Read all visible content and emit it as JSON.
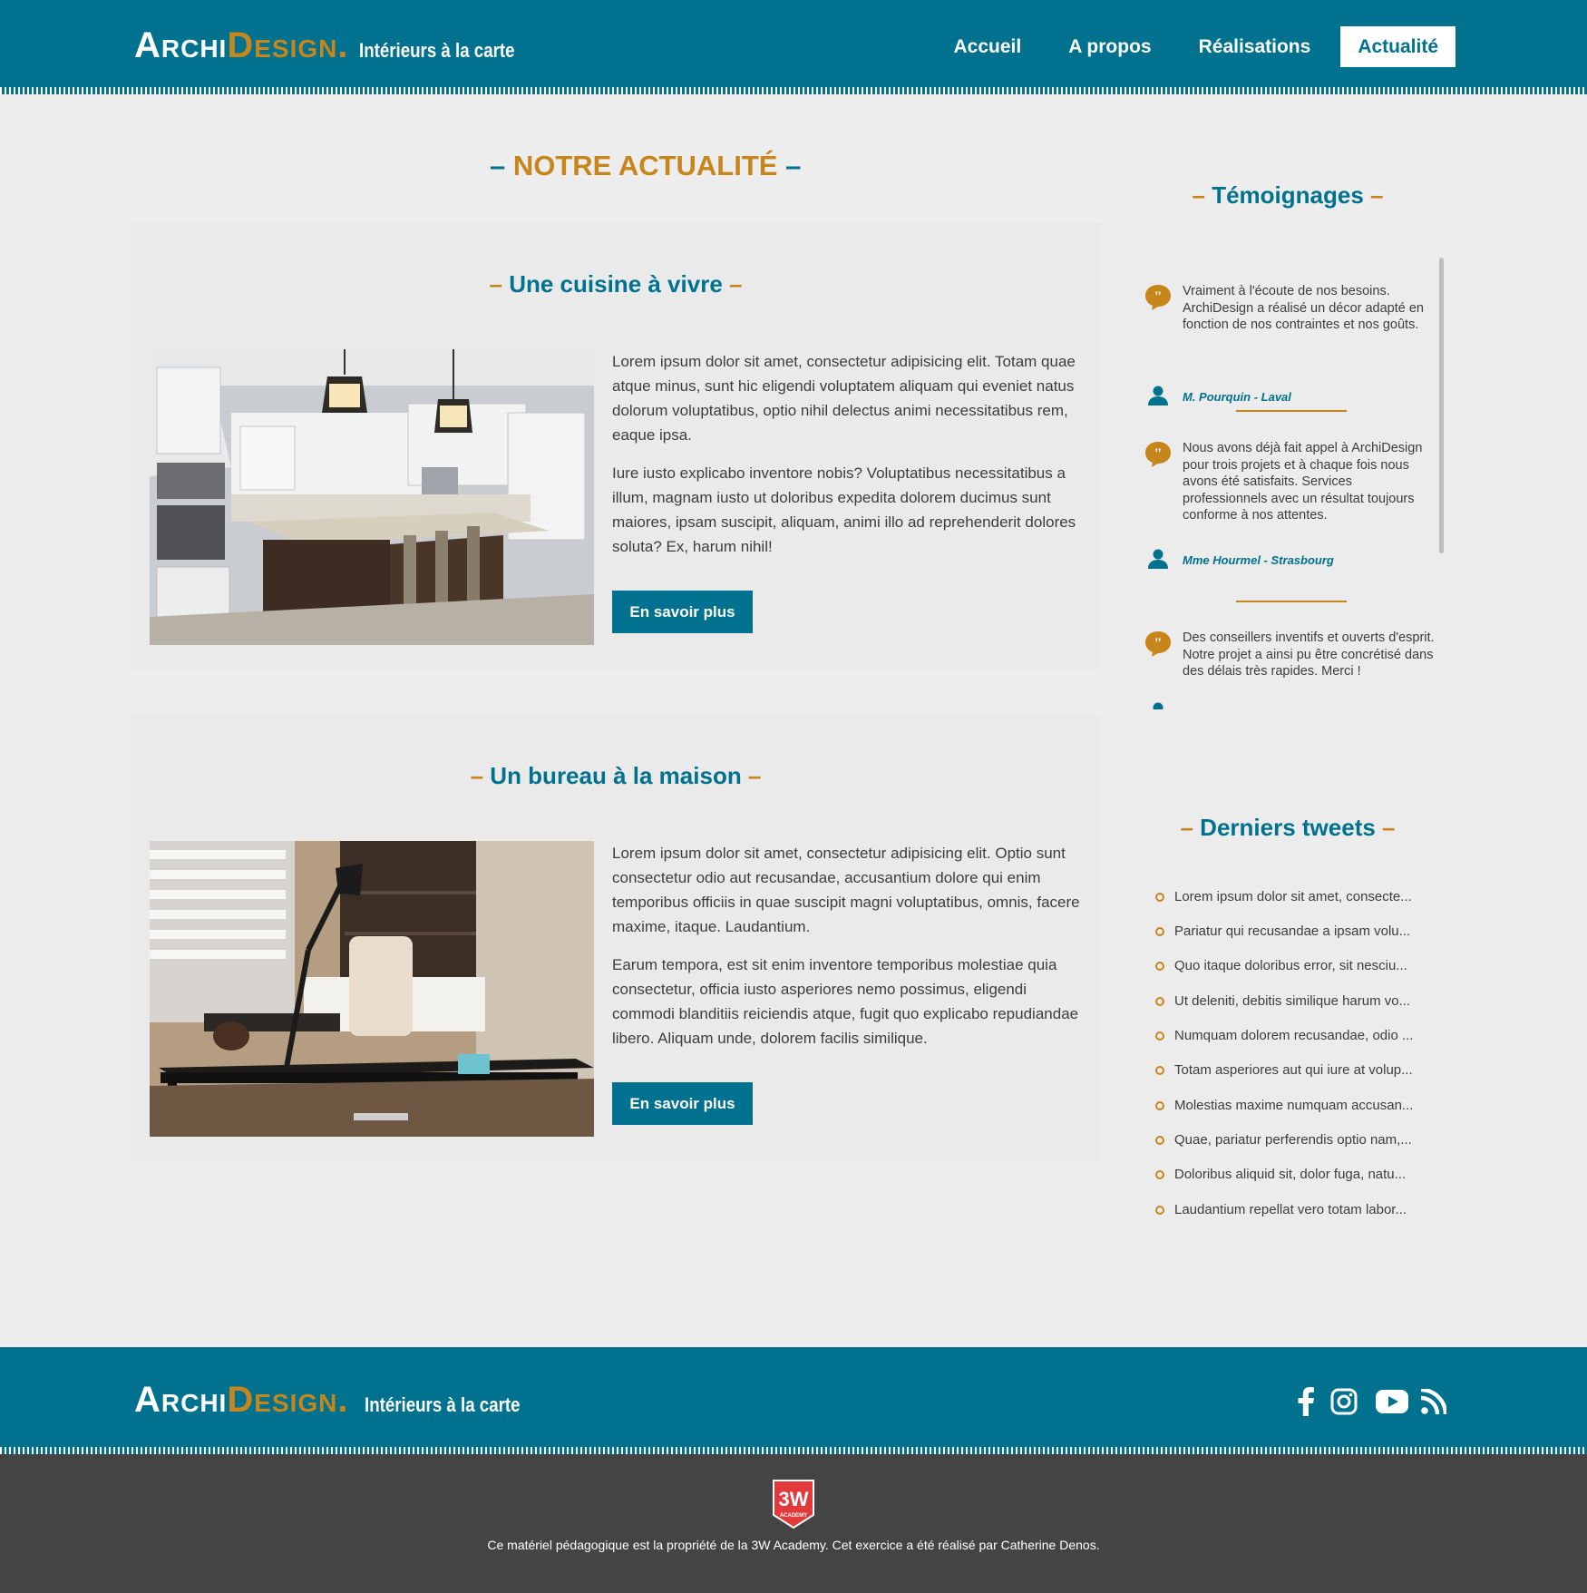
{
  "brand": {
    "archi": "Archi",
    "design": "Design",
    "dot": ".",
    "tagline": "Intérieurs à la carte"
  },
  "nav": [
    {
      "label": "Accueil"
    },
    {
      "label": "A propos"
    },
    {
      "label": "Réalisations"
    },
    {
      "label": "Actualité"
    }
  ],
  "page_title": "NOTRE ACTUALITÉ",
  "articles": [
    {
      "title": "Une cuisine à vivre",
      "p1": "Lorem ipsum dolor sit amet, consectetur adipisicing elit. Totam quae atque minus, sunt hic eligendi voluptatem aliquam qui eveniet natus dolorum voluptatibus, optio nihil delectus animi necessitatibus rem, eaque ipsa.",
      "p2": "Iure iusto explicabo inventore nobis? Voluptatibus necessitatibus a illum, magnam iusto ut doloribus expedita dolorem ducimus sunt maiores, ipsam suscipit, aliquam, animi illo ad reprehenderit dolores soluta? Ex, harum nihil!",
      "button": "En savoir plus"
    },
    {
      "title": "Un bureau à la maison",
      "p1": "Lorem ipsum dolor sit amet, consectetur adipisicing elit. Optio sunt consectetur odio aut recusandae, accusantium dolore qui enim temporibus officiis in quae suscipit magni voluptatibus, omnis, facere maxime, itaque. Laudantium.",
      "p2": "Earum tempora, est sit enim inventore temporibus molestiae quia consectetur, officia iusto asperiores nemo possimus, eligendi commodi blanditiis reiciendis atque, fugit quo explicabo repudiandae libero. Aliquam unde, dolorem facilis similique.",
      "button": "En savoir plus"
    }
  ],
  "sidebar": {
    "testimonials_title": "Témoignages",
    "testimonials": [
      {
        "text": "Vraiment à l'écoute de nos besoins. ArchiDesign a réalisé un décor adapté en fonction de nos contraintes et nos goûts.",
        "author": "M. Pourquin - Laval"
      },
      {
        "text": "Nous avons déjà fait appel à ArchiDesign pour trois projets et à chaque fois nous avons été satisfaits. Services professionnels avec un résultat toujours conforme à nos attentes.",
        "author": "Mme Hourmel - Strasbourg"
      },
      {
        "text": "Des conseillers inventifs et ouverts d'esprit. Notre projet a ainsi pu être concrétisé dans des délais très rapides. Merci !",
        "author": ""
      }
    ],
    "tweets_title": "Derniers tweets",
    "tweets": [
      "Lorem ipsum dolor sit amet, consecte...",
      "Pariatur qui recusandae a ipsam volu...",
      "Quo itaque doloribus error, sit nesciu...",
      "Ut deleniti, debitis similique harum vo...",
      "Numquam dolorem recusandae, odio ...",
      "Totam asperiores aut qui iure at volup...",
      "Molestias maxime numquam accusan...",
      "Quae, pariatur perferendis optio nam,...",
      "Doloribus aliquid sit, dolor fuga, natu...",
      "Laudantium repellat vero totam labor..."
    ]
  },
  "footer": {
    "social": [
      "facebook-icon",
      "instagram-icon",
      "youtube-icon",
      "rss-icon"
    ],
    "academy_logo_text": "3W ACADEMY",
    "copyright": "Ce matériel pédagogique est la propriété de la 3W Academy. Cet exercice a été réalisé par Catherine Denos."
  },
  "colors": {
    "primary": "#00728f",
    "accent": "#c7861b",
    "background": "#ededed",
    "subfooter": "#444444"
  }
}
